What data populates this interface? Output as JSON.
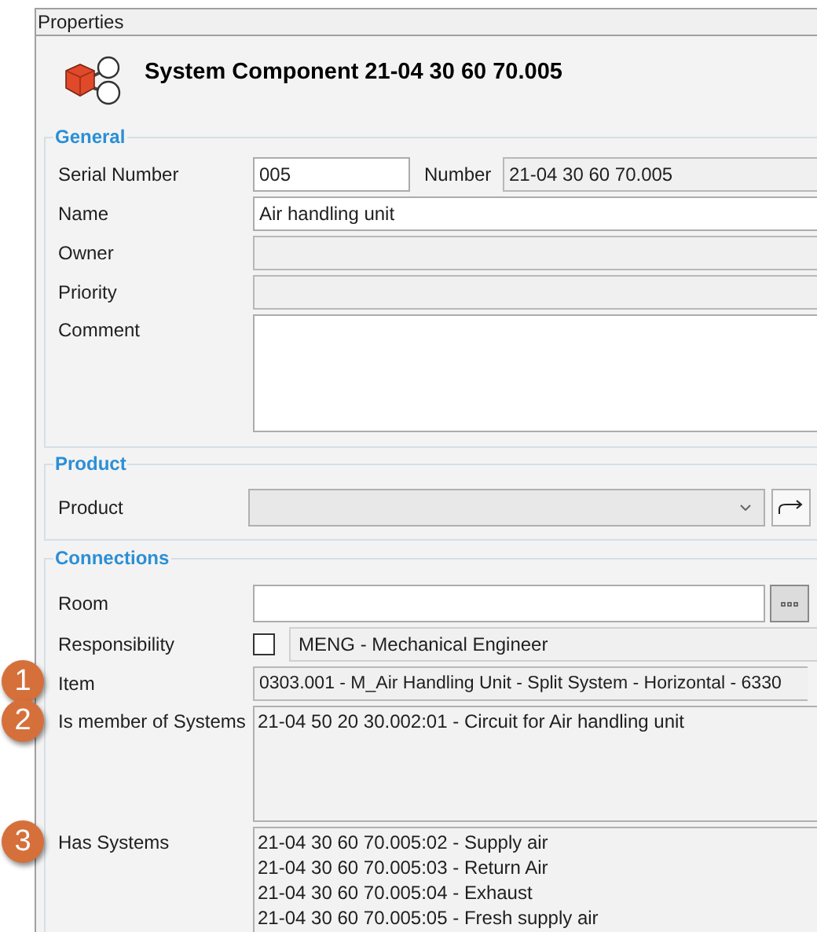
{
  "panel_title": "Properties",
  "header": {
    "title": "System Component 21-04 30 60 70.005"
  },
  "groups": [
    {
      "title": "General",
      "rows": [
        {
          "kind": "pair",
          "label": "Serial Number",
          "value": "005",
          "label_2": "Number",
          "value_2": "21-04 30 60 70.005"
        },
        {
          "kind": "text",
          "label": "Name",
          "value": "Air handling unit",
          "disabled": false
        },
        {
          "kind": "text",
          "label": "Owner",
          "disabled": true
        },
        {
          "kind": "text",
          "label": "Priority",
          "disabled": true
        },
        {
          "kind": "memo",
          "label": "Comment"
        }
      ]
    },
    {
      "title": "Product",
      "rows": [
        {
          "kind": "combo",
          "label": "Product",
          "disabled": true
        }
      ]
    },
    {
      "title": "Connections",
      "rows": [
        {
          "kind": "lookup",
          "label": "Room"
        },
        {
          "kind": "check",
          "label": "Responsibility",
          "checked": false,
          "value": "MENG - Mechanical Engineer"
        },
        {
          "kind": "text",
          "label": "Item",
          "value": "0303.001 - M_Air Handling Unit - Split System - Horizontal - 6330",
          "disabled": true,
          "callout": "1"
        },
        {
          "kind": "list",
          "label": "Is member of Systems",
          "callout": "2",
          "items": [
            "21-04 50 20 30.002:01 - Circuit for Air handling unit"
          ]
        },
        {
          "kind": "list",
          "label": "Has Systems",
          "callout": "3",
          "items": [
            "21-04 30 60 70.005:02 - Supply air",
            "21-04 30 60 70.005:03 - Return Air",
            "21-04 30 60 70.005:04 - Exhaust",
            "21-04 30 60 70.005:05 - Fresh supply air"
          ]
        }
      ]
    }
  ]
}
